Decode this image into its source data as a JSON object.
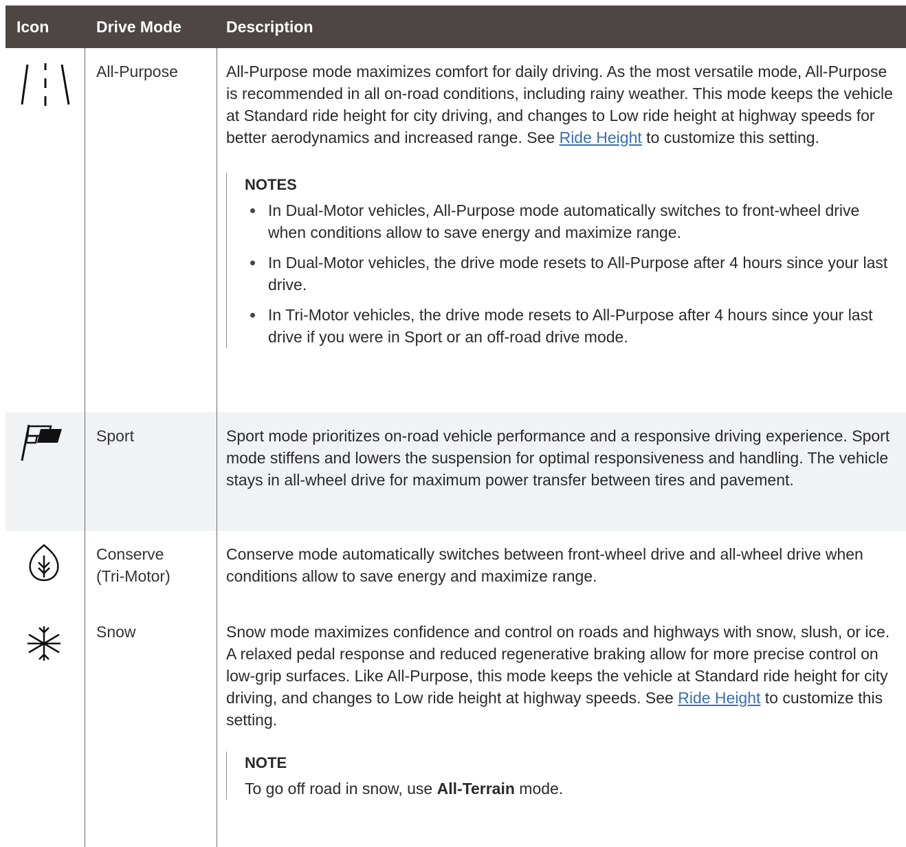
{
  "header": {
    "col_icon": "Icon",
    "col_mode": "Drive Mode",
    "col_desc": "Description"
  },
  "rows": [
    {
      "icon": "road-lanes-icon",
      "mode": "All-Purpose",
      "desc_before": "All-Purpose mode maximizes comfort for daily driving. As the most versatile mode, All-Purpose is recommended in all on-road conditions, including rainy weather. This mode keeps the vehicle at Standard ride height for city driving, and changes to Low ride height at highway speeds for better aerodynamics and increased range. See ",
      "link": "Ride Height",
      "desc_after": " to customize this setting.",
      "note_title": "NOTES",
      "notes": [
        "In Dual-Motor vehicles, All-Purpose mode automatically switches to front-wheel drive when conditions allow to save energy and maximize range.",
        "In Dual-Motor vehicles, the drive mode resets to All-Purpose after 4 hours since your last drive.",
        "In Tri-Motor vehicles, the drive mode resets to All-Purpose after 4 hours since your last drive if you were in Sport or an off-road drive mode."
      ]
    },
    {
      "icon": "checkered-flag-icon",
      "mode": "Sport",
      "desc": "Sport mode prioritizes on-road vehicle performance and a responsive driving experience. Sport mode stiffens and lowers the suspension for optimal responsiveness and handling. The vehicle stays in all-wheel drive for maximum power transfer between tires and pavement."
    },
    {
      "icon": "leaf-icon",
      "mode_line1": "Conserve",
      "mode_line2": "(Tri-Motor)",
      "desc": "Conserve mode automatically switches between front-wheel drive and all-wheel drive when conditions allow to save energy and maximize range."
    },
    {
      "icon": "snowflake-icon",
      "mode": "Snow",
      "desc_before": "Snow mode maximizes confidence and control on roads and highways with snow, slush, or ice. A relaxed pedal response and reduced regenerative braking allow for more precise control on low-grip surfaces. Like All-Purpose, this mode keeps the vehicle at Standard ride height for city driving, and changes to Low ride height at highway speeds. See ",
      "link": "Ride Height",
      "desc_after": " to customize this setting.",
      "note_title": "NOTE",
      "note_before": "To go off road in snow, use ",
      "note_bold": "All-Terrain",
      "note_after": " mode."
    }
  ],
  "colors": {
    "header_bg": "#4d4644",
    "shaded_row": "#f1f2f4",
    "link": "#3a6fb0"
  }
}
